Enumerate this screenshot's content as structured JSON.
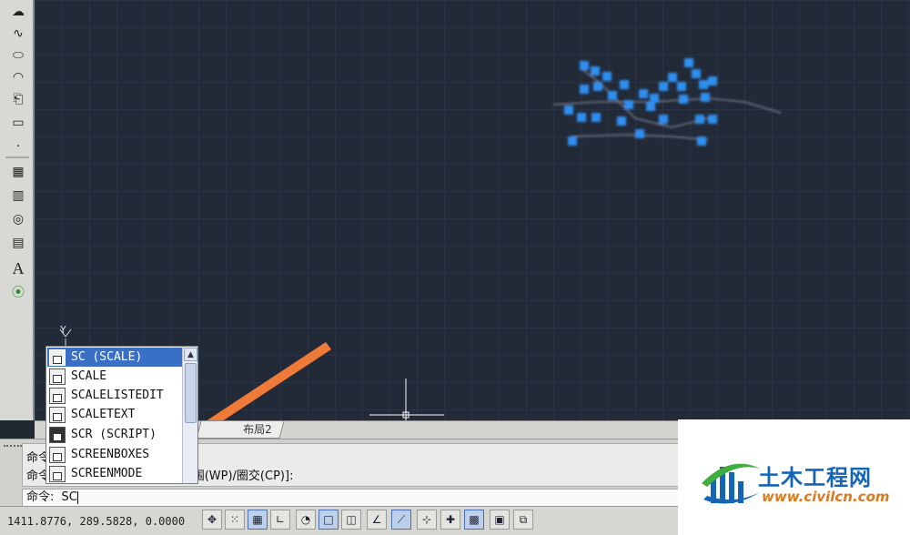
{
  "left_toolbar": {
    "icons": [
      "revcloud-icon",
      "spline-icon",
      "ellipse-icon",
      "ellipse-arc-icon",
      "insert-block-icon",
      "make-block-icon",
      "point-icon",
      "hatch-icon",
      "gradient-icon",
      "region-icon",
      "table-icon",
      "multiline-text-icon",
      "add-selected-icon"
    ],
    "text_tool_glyph": "A"
  },
  "ucs": {
    "y_label": "Y"
  },
  "autocomplete": {
    "items": [
      {
        "label": "SC (SCALE)",
        "icon": "scale-icon",
        "selected": true
      },
      {
        "label": "SCALE",
        "icon": "scale-icon",
        "selected": false
      },
      {
        "label": "SCALELISTEDIT",
        "icon": "scale-list-icon",
        "selected": false
      },
      {
        "label": "SCALETEXT",
        "icon": "scale-text-icon",
        "selected": false
      },
      {
        "label": "SCR (SCRIPT)",
        "icon": "script-icon",
        "selected": false
      },
      {
        "label": "SCREENBOXES",
        "icon": "screen-icon",
        "selected": false
      },
      {
        "label": "SCREENMODE",
        "icon": "screen-icon",
        "selected": false
      }
    ],
    "selected_color": "#3a6fc6"
  },
  "layout_tab": {
    "label": "布局2"
  },
  "command": {
    "history": [
      "命令:",
      "命令:  指定对角点或 [栏选(F)/圈围(WP)/圈交(CP)]:"
    ],
    "prompt": "命令:",
    "input_value": "SC"
  },
  "status_bar": {
    "coordinates": "1411.8776, 289.5828, 0.0000",
    "buttons": [
      "infer-constraints-icon",
      "snap-mode-icon",
      "grid-display-icon",
      "ortho-mode-icon",
      "polar-tracking-icon",
      "object-snap-icon",
      "3d-object-snap-icon",
      "object-snap-tracking-icon",
      "dynamic-ucs-icon",
      "dynamic-input-icon",
      "show-lineweight-icon",
      "transparency-icon",
      "quick-properties-icon",
      "selection-cycling-icon"
    ]
  },
  "watermark": {
    "title": "土木工程网",
    "url": "www.civilcn.com"
  },
  "colors": {
    "canvas_bg": "#222a38",
    "grip_blue": "#2f8ff0",
    "arrow_orange": "#f07a38"
  }
}
